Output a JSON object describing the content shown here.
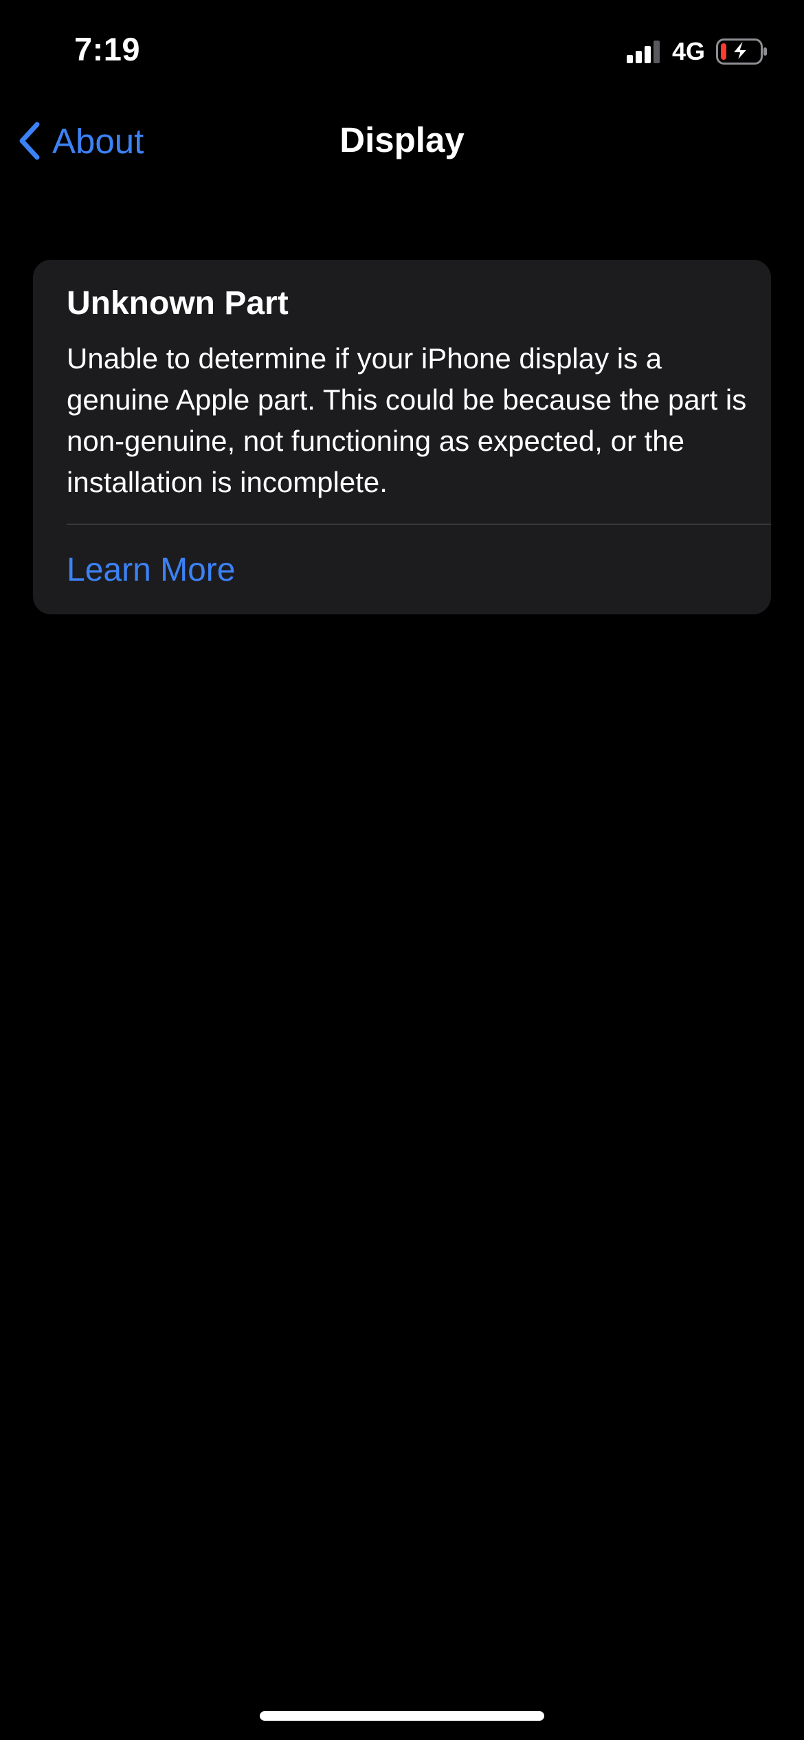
{
  "status_bar": {
    "time": "7:19",
    "network": "4G",
    "signal_icon": "cellular-signal-icon",
    "battery_icon": "battery-charging-icon",
    "battery_level_percent": 15,
    "colors": {
      "battery_low": "#ff3b30"
    }
  },
  "nav": {
    "back_label": "About",
    "back_icon": "chevron-left-icon",
    "title": "Display"
  },
  "card": {
    "title": "Unknown Part",
    "body": "Unable to determine if your iPhone display is a genuine Apple part. This could be because the part is non-genuine, not functioning as expected, or the installation is incomplete.",
    "link_label": "Learn More"
  },
  "colors": {
    "background": "#000000",
    "card_background": "#1c1c1e",
    "accent": "#3c82f6",
    "text": "#ffffff"
  }
}
